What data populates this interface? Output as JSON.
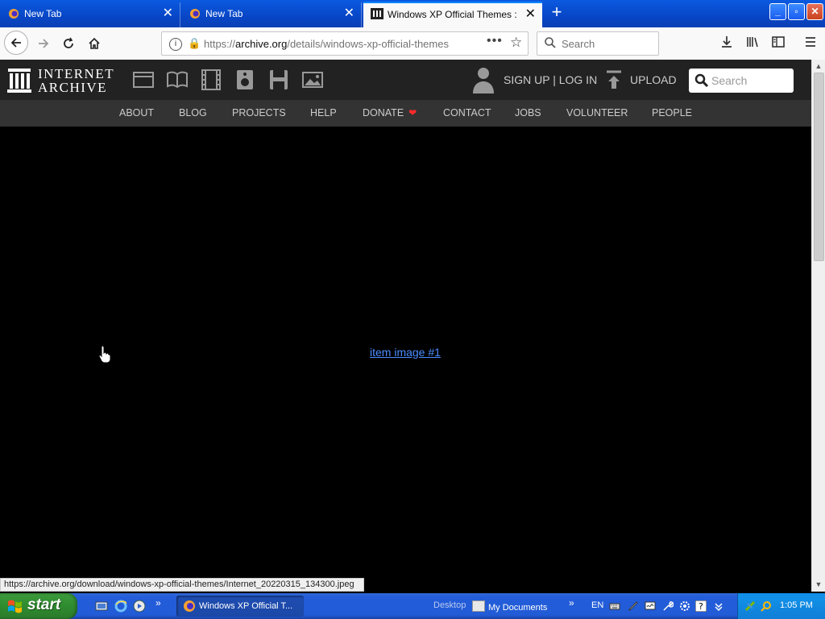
{
  "browser": {
    "tabs": [
      {
        "title": "New Tab",
        "active": false
      },
      {
        "title": "New Tab",
        "active": false
      },
      {
        "title": "Windows XP Official Themes : Mic",
        "active": true
      }
    ],
    "url_prefix": "https://",
    "url_host": "archive.org",
    "url_path": "/details/windows-xp-official-themes",
    "search_placeholder": "Search",
    "new_tab_label": "+",
    "close_glyph": "✕"
  },
  "ia_header": {
    "logo_line1": "INTERNET",
    "logo_line2": "ARCHIVE",
    "signup_label": "SIGN UP | LOG IN",
    "upload_label": "UPLOAD",
    "search_placeholder": "Search",
    "media_icons": [
      "web-icon",
      "texts-icon",
      "video-icon",
      "audio-icon",
      "software-icon",
      "images-icon"
    ]
  },
  "subnav": {
    "items": [
      "ABOUT",
      "BLOG",
      "PROJECTS",
      "HELP",
      "DONATE",
      "CONTACT",
      "JOBS",
      "VOLUNTEER",
      "PEOPLE"
    ],
    "donate_heart": "❤",
    "heart_color": "#ff2a2a"
  },
  "main": {
    "item_link": "item image #1"
  },
  "status_bar": {
    "text": "https://archive.org/download/windows-xp-official-themes/Internet_20220315_134300.jpeg"
  },
  "taskbar": {
    "start_label": "start",
    "task_button": "Windows XP Official T...",
    "desktop_label": "Desktop",
    "mydocs_label": "My Documents",
    "lang": "EN",
    "clock": "1:05 PM",
    "chevron": "»"
  },
  "colors": {
    "xp_blue": "#245dda",
    "start_green": "#2f8c2f",
    "ia_header_bg": "#222222",
    "ia_subnav_bg": "#333333",
    "link_blue": "#4a8cff"
  }
}
